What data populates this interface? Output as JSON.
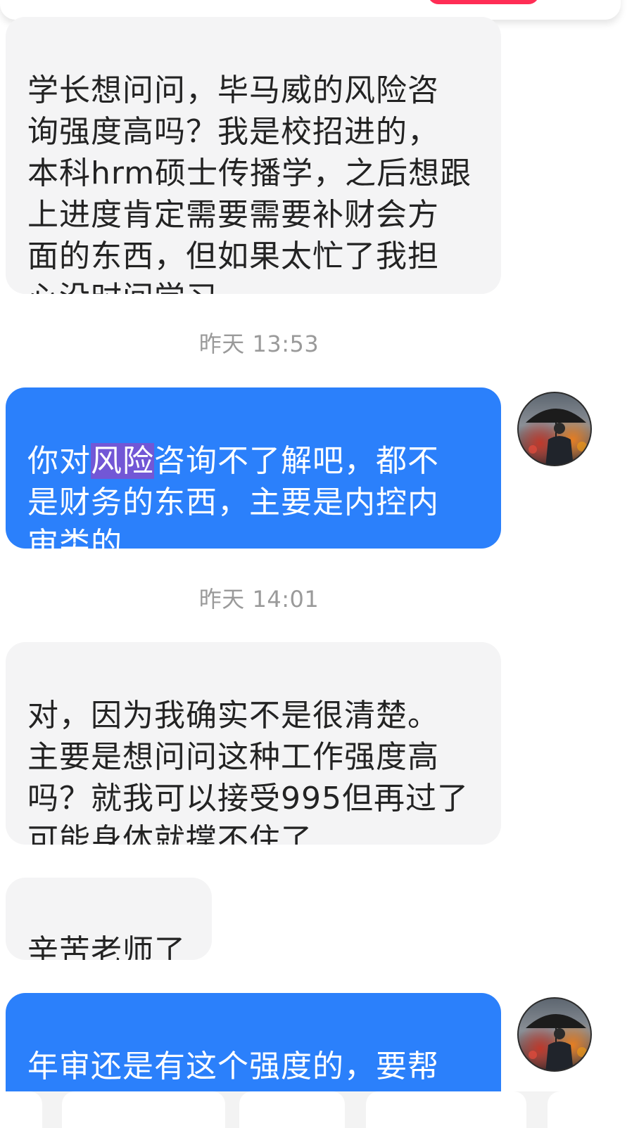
{
  "messages": [
    {
      "sender": "other",
      "text": "学长想问问，毕马威的风险咨\n询强度高吗？我是校招进的，\n本科hrm硕士传播学，之后想跟\n上进度肯定需要需要补财会方\n面的东西，但如果太忙了我担\n心没时间学习……"
    },
    {
      "timestamp": "昨天 13:53"
    },
    {
      "sender": "me",
      "text_before": "你对",
      "text_highlight": "风险",
      "text_after": "咨询不了解吧，都不\n是财务的东西，主要是内控内\n审类的"
    },
    {
      "timestamp": "昨天 14:01"
    },
    {
      "sender": "other",
      "text": "对，因为我确实不是很清楚。\n主要是想问问这种工作强度高\n吗？就我可以接受995但再过了\n可能身体就撑不住了"
    },
    {
      "sender": "other",
      "text": "辛苦老师了"
    },
    {
      "sender": "me",
      "text": "年审还是有这个强度的，要帮\n审计项目组做项目，基本随年"
    }
  ],
  "colors": {
    "incoming_bubble": "#f4f4f5",
    "outgoing_bubble": "#2b80fb",
    "selection_highlight": "#7257d6",
    "timestamp_text": "#9a9a9a",
    "accent_red": "#ff2d55"
  },
  "icons": {
    "avatar": "avatar-man-with-umbrella"
  }
}
